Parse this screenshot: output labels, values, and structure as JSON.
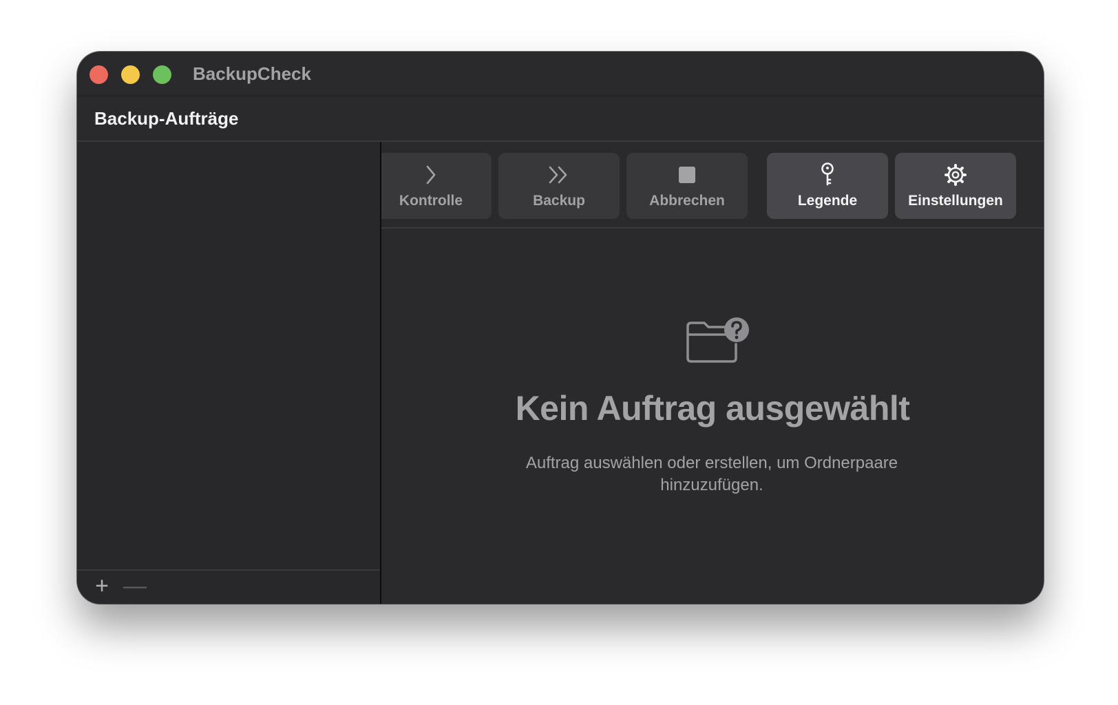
{
  "window": {
    "app_title": "BackupCheck"
  },
  "sidebar": {
    "header_title": "Backup-Aufträge",
    "footer": {
      "add_glyph": "+",
      "remove_glyph": "—"
    }
  },
  "toolbar": {
    "buttons": [
      {
        "label": "Kontrolle",
        "icon": "chevron-right-icon"
      },
      {
        "label": "Backup",
        "icon": "double-chevron-right-icon"
      },
      {
        "label": "Abbrechen",
        "icon": "stop-square-icon"
      },
      {
        "label": "Legende",
        "icon": "key-icon"
      },
      {
        "label": "Einstellungen",
        "icon": "gear-icon"
      }
    ]
  },
  "empty_state": {
    "icon": "folder-question-icon",
    "title": "Kein Auftrag ausgewählt",
    "subtitle": "Auftrag auswählen oder erstellen, um Ordnerpaare hinzuzufügen."
  },
  "colors": {
    "window_bg": "#2a2a2c",
    "close": "#ec6a5e",
    "minimize": "#f4c94a",
    "maximize": "#6cc15c",
    "muted_text": "#a3a3a6"
  }
}
